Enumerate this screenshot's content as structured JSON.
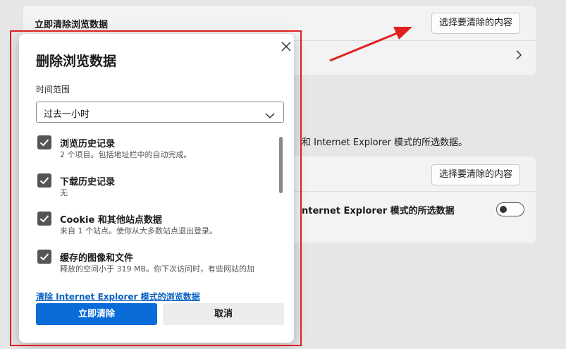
{
  "background": {
    "section_title": "立即清除浏览数据",
    "choose_button_1": "选择要清除的内容",
    "choose_button_2": "选择要清除的内容",
    "description": "和 Internet Explorer 模式的所选数据。",
    "toggle_label": "nternet Explorer 模式的所选数据",
    "toggle_on": false
  },
  "dialog": {
    "title": "删除浏览数据",
    "time_range_label": "时间范围",
    "time_range_value": "过去一小时",
    "items": [
      {
        "title": "浏览历史记录",
        "desc": "2 个项目。包括地址栏中的自动完成。",
        "checked": true
      },
      {
        "title": "下载历史记录",
        "desc": "无",
        "checked": true
      },
      {
        "title": "Cookie 和其他站点数据",
        "desc": "来自 1 个站点。使你从大多数站点退出登录。",
        "checked": true
      },
      {
        "title": "缓存的图像和文件",
        "desc": "释放的空间小于 319 MB。你下次访问时，有些网站的加",
        "checked": true
      }
    ],
    "ie_link": "清除 Internet Explorer 模式的浏览数据",
    "clear_button": "立即清除",
    "cancel_button": "取消"
  },
  "colors": {
    "accent": "#0a6cd6",
    "annotation_red": "#e02020",
    "link": "#0b63c4"
  },
  "icons": [
    "close-icon",
    "chevron-down-icon",
    "chevron-right-icon",
    "checkbox-checked-icon",
    "annotation-arrow"
  ]
}
